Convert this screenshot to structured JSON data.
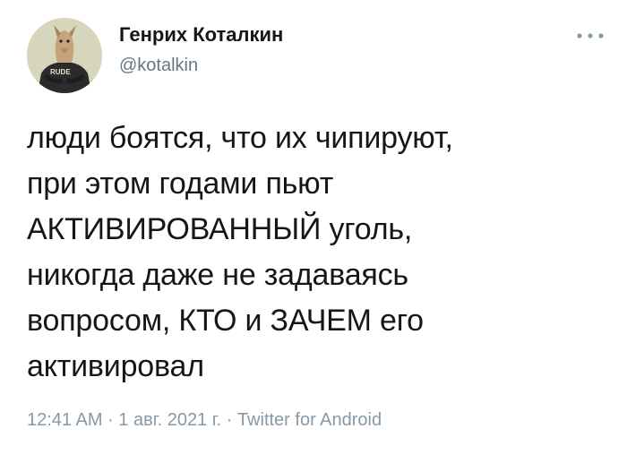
{
  "tweet": {
    "author": {
      "display_name": "Генрих Коталкин",
      "handle": "@kotalkin",
      "avatar_shirt_text": "RUDE"
    },
    "text": "люди боятся, что их чипируют,\nпри этом годами пьют\nАКТИВИРОВАННЫЙ уголь,\nникогда даже не задаваясь\nвопросом, КТО и ЗАЧЕМ его\nактивировал",
    "time": "12:41 AM",
    "separator": " · ",
    "date": "1 авг. 2021 г.",
    "source": "Twitter for Android",
    "more_icon": "more-dots-icon"
  },
  "colors": {
    "text": "#14171a",
    "secondary": "#657786",
    "meta": "#8899a6",
    "background": "#ffffff"
  }
}
